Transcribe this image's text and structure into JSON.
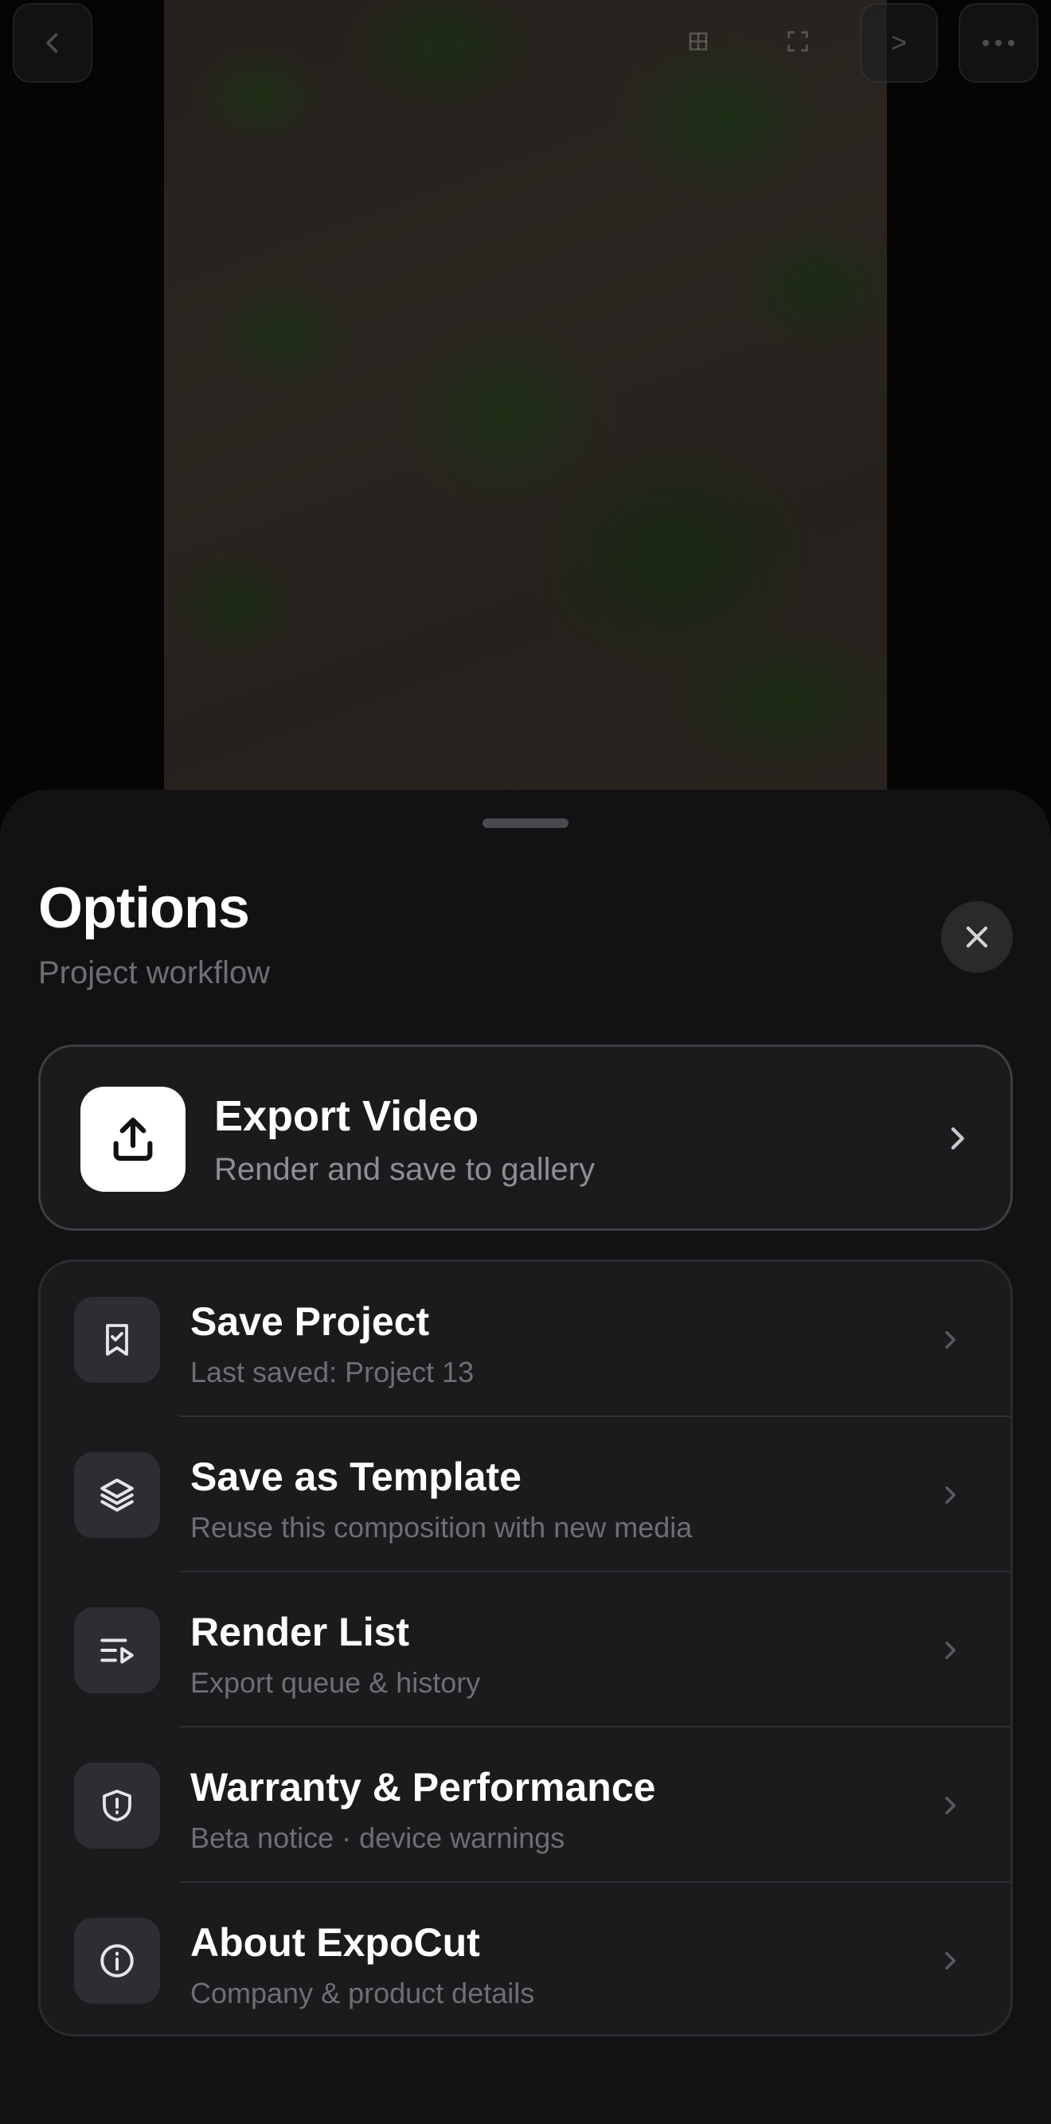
{
  "top_bar": {
    "back_icon": "chevron-left-icon",
    "grid_icon": "grid-icon",
    "fullscreen_icon": "fullscreen-icon",
    "next_label": ">",
    "more_icon": "ellipsis-icon"
  },
  "preview": {
    "description_icon": "video-preview"
  },
  "sheet": {
    "title": "Options",
    "subtitle": "Project workflow",
    "close_icon": "close-icon"
  },
  "export": {
    "title": "Export Video",
    "subtitle": "Render and save to gallery",
    "icon": "upload-icon"
  },
  "list": {
    "items": [
      {
        "title": "Save Project",
        "subtitle": "Last saved: Project 13",
        "icon": "bookmark-check-icon"
      },
      {
        "title": "Save as Template",
        "subtitle": "Reuse this composition with new media",
        "icon": "layers-icon"
      },
      {
        "title": "Render List",
        "subtitle": "Export queue & history",
        "icon": "playlist-icon"
      },
      {
        "title": "Warranty & Performance",
        "subtitle": "Beta notice · device warnings",
        "icon": "shield-alert-icon"
      },
      {
        "title": "About ExpoCut",
        "subtitle": "Company & product details",
        "icon": "info-icon"
      }
    ]
  },
  "colors": {
    "sheet_bg": "#121214",
    "card_bg": "#1b1b1e",
    "secondary_text": "#6e6e73",
    "accent_white": "#ffffff"
  }
}
